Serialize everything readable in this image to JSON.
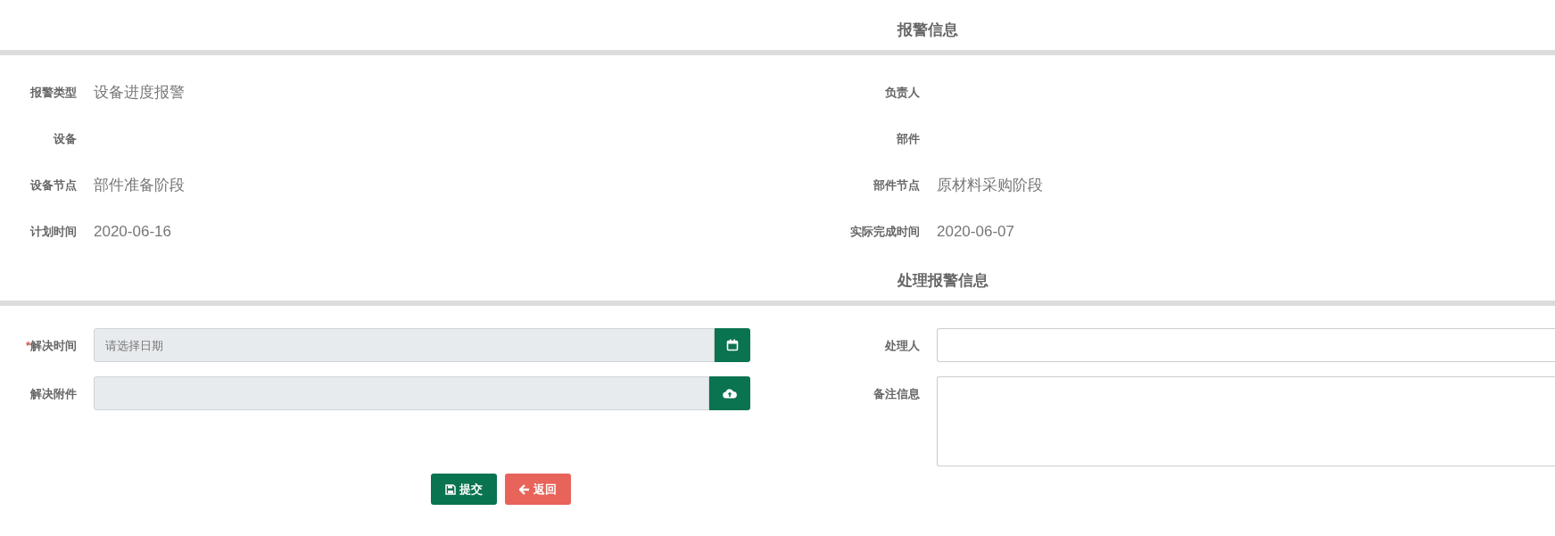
{
  "alarm_info": {
    "title": "报警信息",
    "left": [
      {
        "label": "报警类型",
        "value": "设备进度报警"
      },
      {
        "label": "设备"
      },
      {
        "label": "设备节点",
        "value": "部件准备阶段"
      },
      {
        "label": "计划时间",
        "value": "2020-06-16"
      }
    ],
    "right": [
      {
        "label": "负责人"
      },
      {
        "label": "部件"
      },
      {
        "label": "部件节点",
        "value": "原材料采购阶段"
      },
      {
        "label": "实际完成时间",
        "value": "2020-06-07"
      }
    ]
  },
  "handling_info": {
    "title": "处理报警信息",
    "left": [
      {
        "kind": "date",
        "required_mark": "*",
        "label": "解决时间",
        "placeholder": "请选择日期"
      },
      {
        "kind": "file",
        "label": "解决附件"
      }
    ],
    "right": [
      {
        "kind": "text",
        "label": "处理人"
      },
      {
        "kind": "textarea",
        "label": "备注信息"
      }
    ]
  },
  "buttons": [
    {
      "kind": "submit",
      "label": "提交"
    },
    {
      "kind": "back",
      "label": "返回"
    }
  ]
}
